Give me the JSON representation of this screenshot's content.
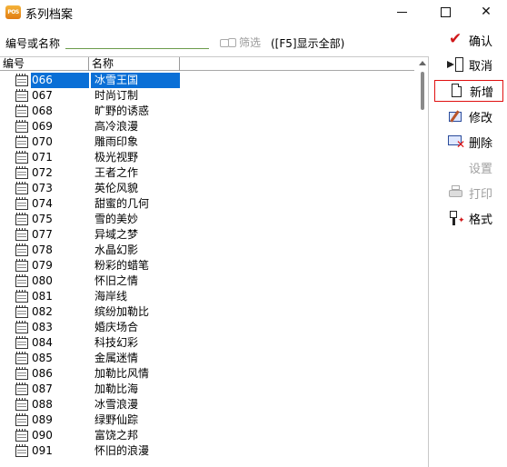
{
  "window": {
    "title": "系列档案",
    "app_icon_text": "POS"
  },
  "search": {
    "label": "编号或名称",
    "value": "",
    "filter_label": "筛选",
    "hint": "([F5]显示全部)"
  },
  "list": {
    "columns": [
      "编号",
      "名称"
    ],
    "selected_code": "066",
    "rows": [
      {
        "code": "066",
        "name": "冰雪王国"
      },
      {
        "code": "067",
        "name": "时尚订制"
      },
      {
        "code": "068",
        "name": "旷野的诱惑"
      },
      {
        "code": "069",
        "name": "高冷浪漫"
      },
      {
        "code": "070",
        "name": "雕雨印象"
      },
      {
        "code": "071",
        "name": "极光视野"
      },
      {
        "code": "072",
        "name": "王者之作"
      },
      {
        "code": "073",
        "name": "英伦风貌"
      },
      {
        "code": "074",
        "name": "甜蜜的几何"
      },
      {
        "code": "075",
        "name": "雪的美妙"
      },
      {
        "code": "077",
        "name": "异域之梦"
      },
      {
        "code": "078",
        "name": "水晶幻影"
      },
      {
        "code": "079",
        "name": "粉彩的蜡笔"
      },
      {
        "code": "080",
        "name": "怀旧之情"
      },
      {
        "code": "081",
        "name": "海岸线"
      },
      {
        "code": "082",
        "name": "缤纷加勒比"
      },
      {
        "code": "083",
        "name": "婚庆场合"
      },
      {
        "code": "084",
        "name": "科技幻彩"
      },
      {
        "code": "085",
        "name": "金属迷情"
      },
      {
        "code": "086",
        "name": "加勒比风情"
      },
      {
        "code": "087",
        "name": "加勒比海"
      },
      {
        "code": "088",
        "name": "冰雪浪漫"
      },
      {
        "code": "089",
        "name": "绿野仙踪"
      },
      {
        "code": "090",
        "name": " 富饶之邦"
      },
      {
        "code": "091",
        "name": "怀旧的浪漫"
      }
    ]
  },
  "toolbar": {
    "confirm": "确认",
    "cancel": "取消",
    "new": "新增",
    "edit": "修改",
    "delete": "删除",
    "settings": "设置",
    "print": "打印",
    "format": "格式"
  },
  "colors": {
    "selection": "#0a6fd6",
    "focus_border": "#e01010",
    "confirm_check": "#d0181a",
    "disabled_text": "#a0a0a0"
  }
}
